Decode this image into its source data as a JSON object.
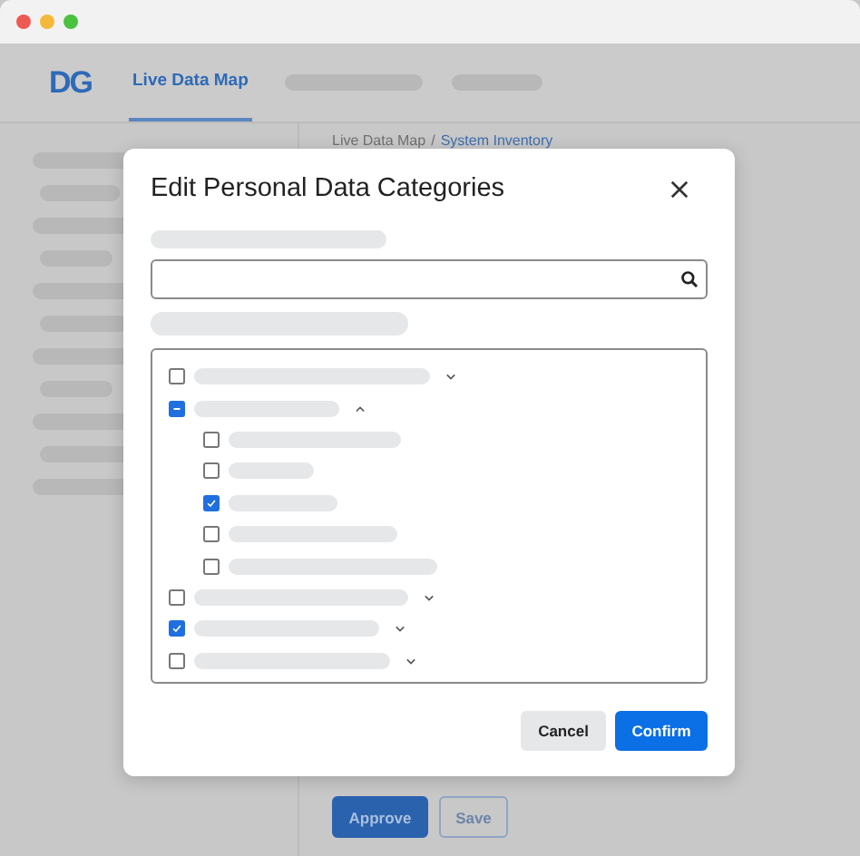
{
  "app": {
    "logo": "DG",
    "tabs": [
      {
        "label": "Live Data Map",
        "selected": true
      }
    ],
    "breadcrumb": {
      "parent": "Live Data Map",
      "separator": "/",
      "current": "System Inventory"
    },
    "page_buttons": [
      {
        "label": "Approve",
        "kind": "primary"
      },
      {
        "label": "Save",
        "kind": "secondary"
      }
    ]
  },
  "dialog": {
    "title": "Edit Personal Data Categories",
    "tree": [
      {
        "checked": false,
        "expanded": false
      },
      {
        "indeterminate": true,
        "expanded": true,
        "children": [
          {
            "checked": false
          },
          {
            "checked": false
          },
          {
            "checked": true
          },
          {
            "checked": false
          },
          {
            "checked": false
          }
        ]
      },
      {
        "checked": false,
        "expanded": false
      },
      {
        "checked": true,
        "expanded": false
      },
      {
        "checked": false,
        "expanded": false
      }
    ],
    "buttons": [
      {
        "label": "Cancel",
        "kind": "secondary"
      },
      {
        "label": "Confirm",
        "kind": "primary"
      }
    ]
  }
}
